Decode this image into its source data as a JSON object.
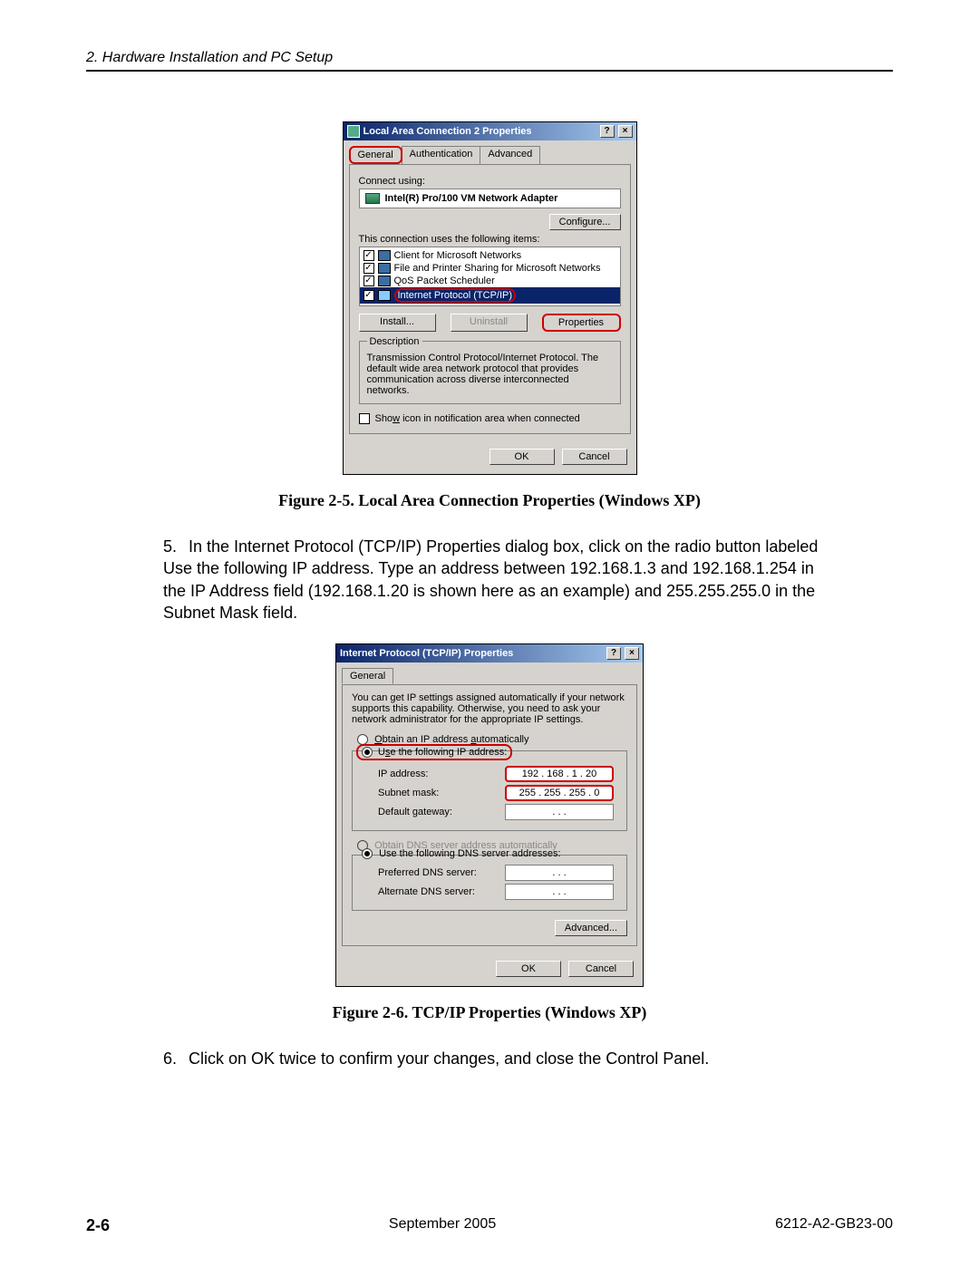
{
  "header": {
    "section_title": "2. Hardware Installation and PC Setup"
  },
  "dialog1": {
    "title": "Local Area Connection 2 Properties",
    "help_btn": "?",
    "close_btn": "×",
    "tabs": {
      "general": "General",
      "auth": "Authentication",
      "adv": "Advanced"
    },
    "connect_using": "Connect using:",
    "adapter": "Intel(R) Pro/100 VM Network Adapter",
    "configure": "Configure...",
    "uses_items": "This connection uses the following items:",
    "items": {
      "client": "Client for Microsoft Networks",
      "file": "File and Printer Sharing for Microsoft Networks",
      "qos": "QoS Packet Scheduler",
      "tcpip": "Internet Protocol (TCP/IP)"
    },
    "install": "Install...",
    "uninstall": "Uninstall",
    "properties": "Properties",
    "desc_label": "Description",
    "desc_text": "Transmission Control Protocol/Internet Protocol. The default wide area network protocol that provides communication across diverse interconnected networks.",
    "show_icon": "Show icon in notification area when connected",
    "ok": "OK",
    "cancel": "Cancel"
  },
  "caption1": "Figure 2-5.    Local Area Connection Properties (Windows XP)",
  "step5": "In the Internet Protocol (TCP/IP) Properties dialog box, click on the radio button labeled Use the following IP address. Type an address between 192.168.1.3 and 192.168.1.254 in the IP Address field (192.168.1.20 is shown here as an example) and 255.255.255.0 in the Subnet Mask field.",
  "step5_num": "5.",
  "dialog2": {
    "title": "Internet Protocol (TCP/IP) Properties",
    "help_btn": "?",
    "close_btn": "×",
    "tab_general": "General",
    "intro": "You can get IP settings assigned automatically if your network supports this capability. Otherwise, you need to ask your network administrator for the appropriate IP settings.",
    "obtain_auto": "Obtain an IP address automatically",
    "use_following": "Use the following IP address:",
    "ip_label": "IP address:",
    "ip_value": "192 . 168 .   1  .  20",
    "subnet_label": "Subnet mask:",
    "subnet_value": "255 . 255 . 255 .   0",
    "gateway_label": "Default gateway:",
    "gateway_value": ".       .       .",
    "obtain_dns_auto": "Obtain DNS server address automatically",
    "use_dns": "Use the following DNS server addresses:",
    "pref_dns": "Preferred DNS server:",
    "alt_dns": "Alternate DNS server:",
    "dns_value": ".       .       .",
    "advanced": "Advanced...",
    "ok": "OK",
    "cancel": "Cancel"
  },
  "caption2": "Figure 2-6.    TCP/IP Properties (Windows XP)",
  "step6_num": "6.",
  "step6": "Click on OK  twice to confirm your changes, and close the Control Panel.",
  "footer": {
    "page_num": "2-6",
    "date": "September 2005",
    "doc_id": "6212-A2-GB23-00"
  }
}
